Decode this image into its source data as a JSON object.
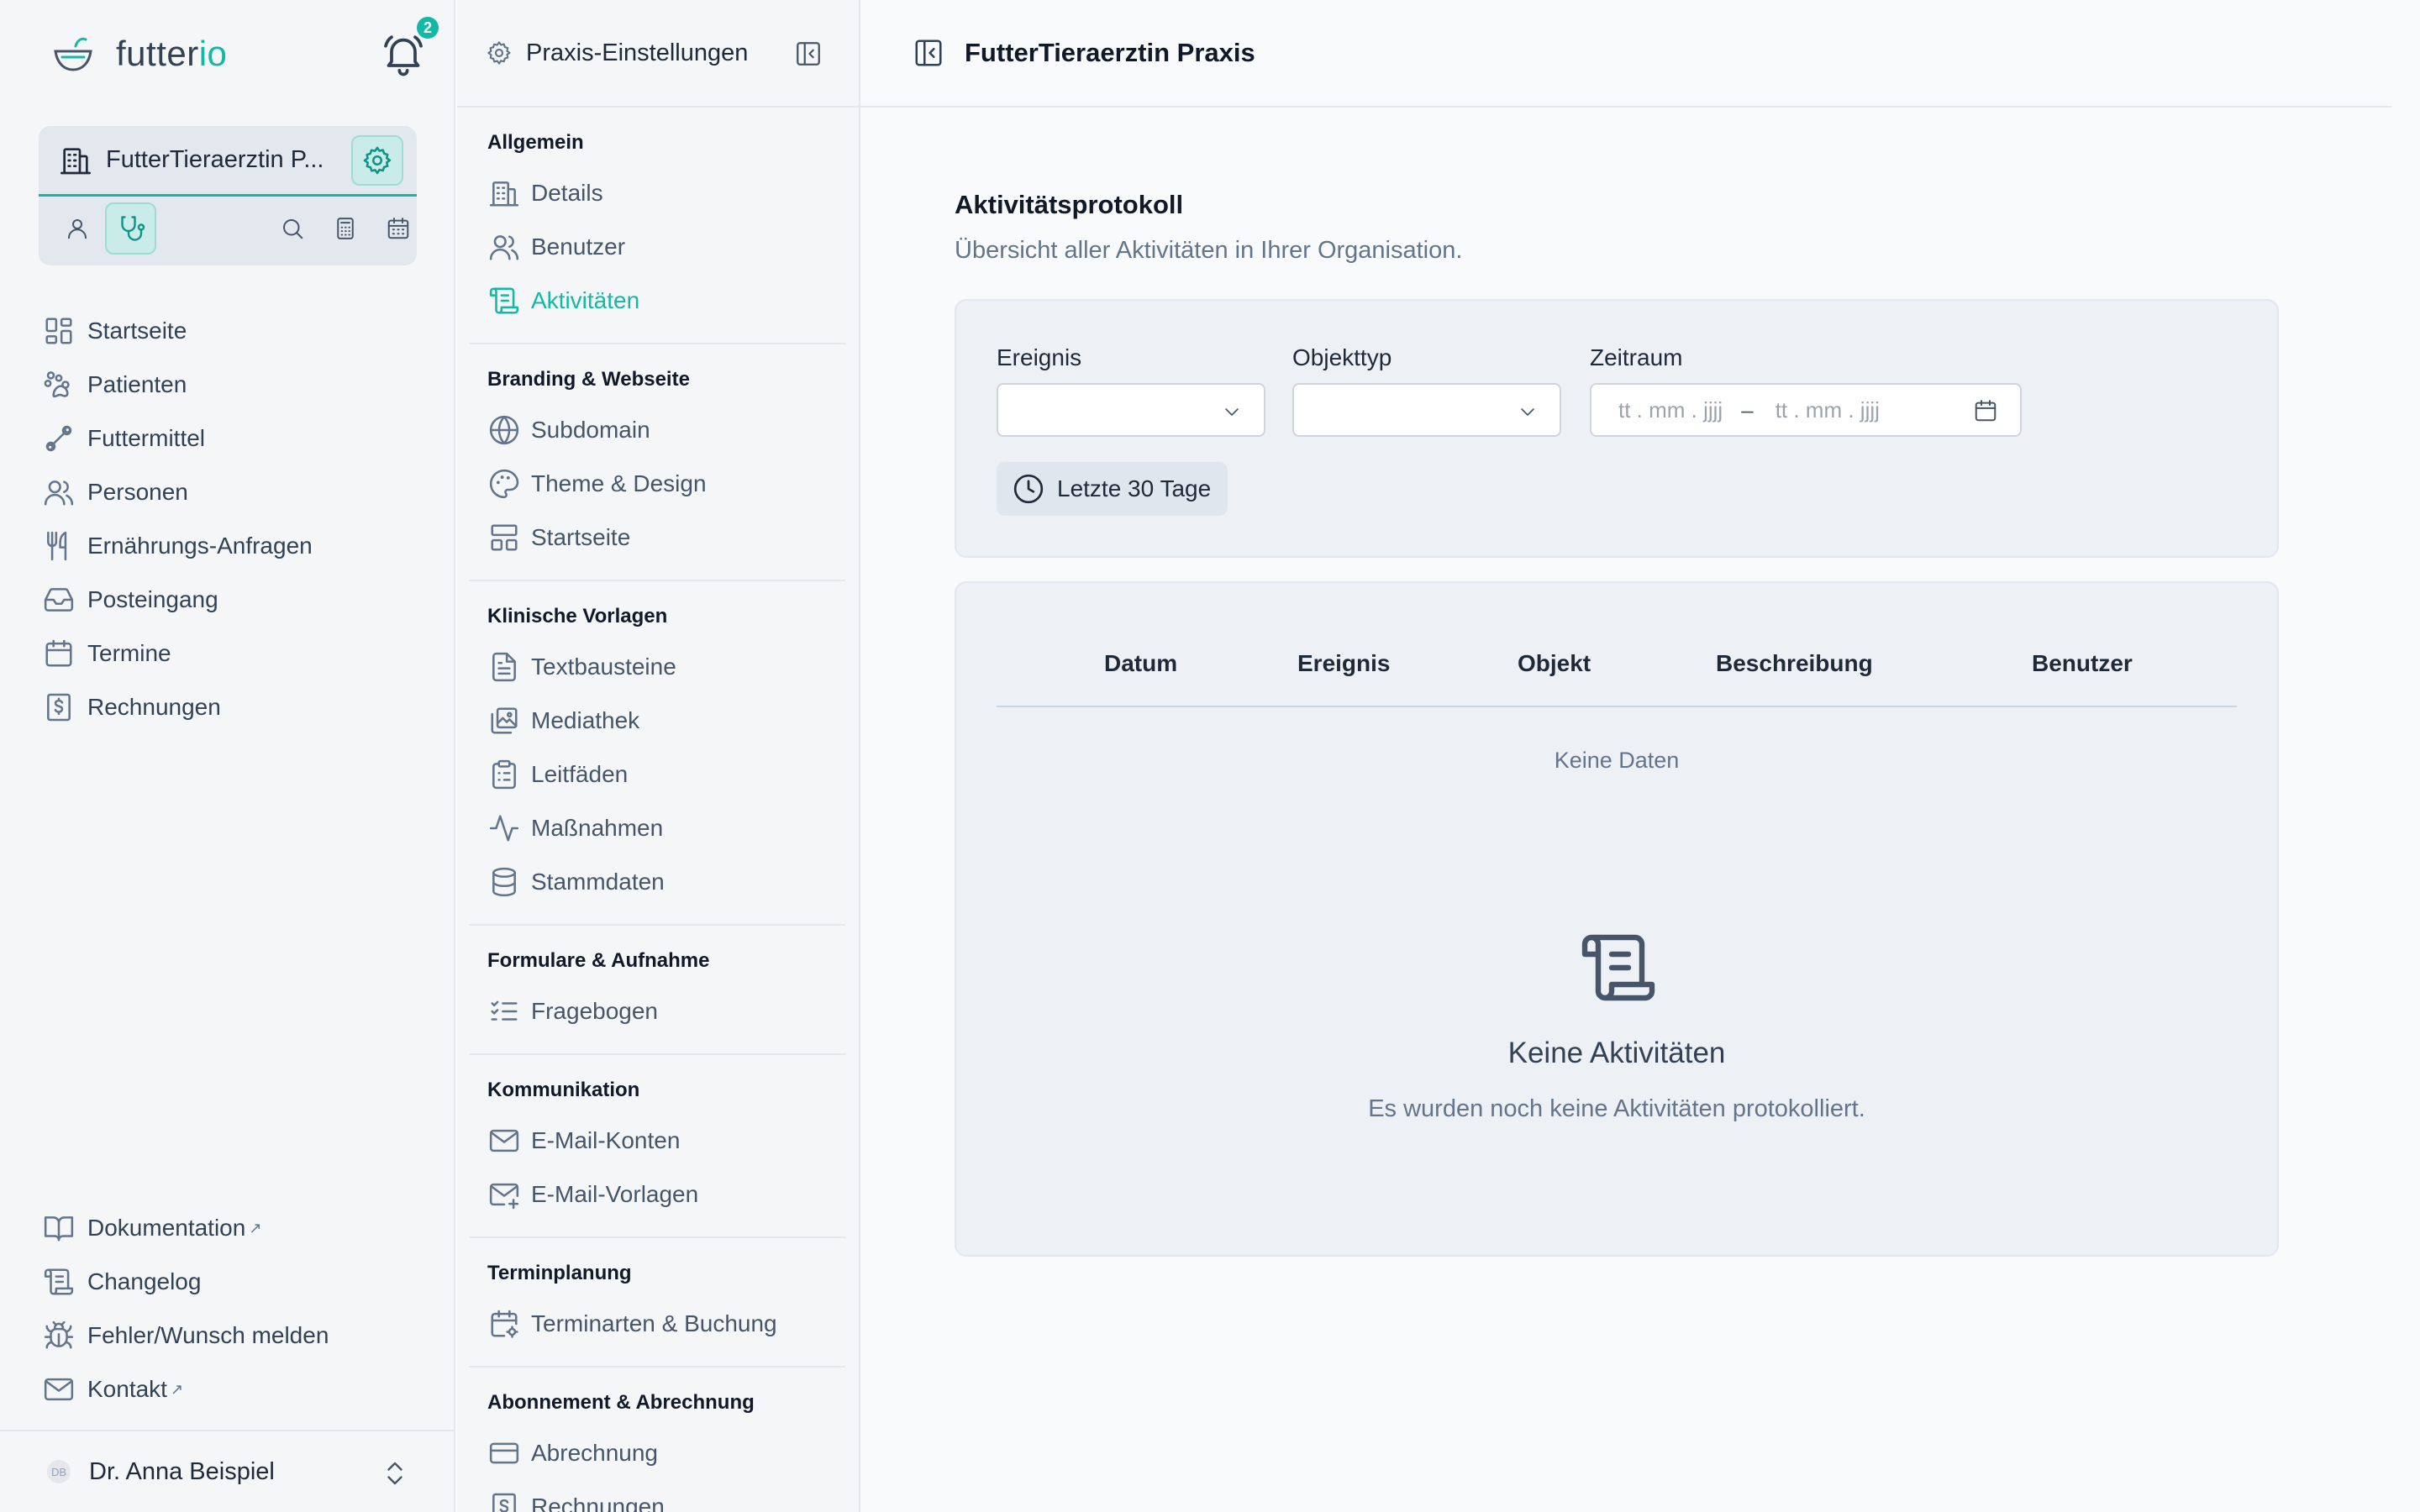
{
  "brand": {
    "name_main": "futter",
    "name_accent": "io",
    "notification_count": "2"
  },
  "org": {
    "name": "FutterTieraerztin P..."
  },
  "nav": {
    "items": [
      {
        "label": "Startseite",
        "icon": "dashboard-icon"
      },
      {
        "label": "Patienten",
        "icon": "paw-icon"
      },
      {
        "label": "Futtermittel",
        "icon": "bone-icon"
      },
      {
        "label": "Personen",
        "icon": "users-icon"
      },
      {
        "label": "Ernährungs-Anfragen",
        "icon": "utensils-icon"
      },
      {
        "label": "Posteingang",
        "icon": "inbox-icon"
      },
      {
        "label": "Termine",
        "icon": "calendar-icon"
      },
      {
        "label": "Rechnungen",
        "icon": "invoice-icon"
      }
    ],
    "footer": [
      {
        "label": "Dokumentation",
        "icon": "book-icon",
        "external": "↗"
      },
      {
        "label": "Changelog",
        "icon": "scroll-icon",
        "external": ""
      },
      {
        "label": "Fehler/Wunsch melden",
        "icon": "bug-icon",
        "external": ""
      },
      {
        "label": "Kontakt",
        "icon": "mail-icon",
        "external": "↗"
      }
    ]
  },
  "user": {
    "initials": "DB",
    "name": "Dr. Anna Beispiel"
  },
  "settings": {
    "title": "Praxis-Einstellungen",
    "sections": [
      {
        "title": "Allgemein",
        "items": [
          {
            "label": "Details",
            "icon": "building-icon"
          },
          {
            "label": "Benutzer",
            "icon": "users-icon"
          },
          {
            "label": "Aktivitäten",
            "icon": "scroll-icon",
            "active": true
          }
        ]
      },
      {
        "title": "Branding & Webseite",
        "items": [
          {
            "label": "Subdomain",
            "icon": "globe-icon"
          },
          {
            "label": "Theme & Design",
            "icon": "palette-icon"
          },
          {
            "label": "Startseite",
            "icon": "layout-icon"
          }
        ]
      },
      {
        "title": "Klinische Vorlagen",
        "items": [
          {
            "label": "Textbausteine",
            "icon": "document-icon"
          },
          {
            "label": "Mediathek",
            "icon": "images-icon"
          },
          {
            "label": "Leitfäden",
            "icon": "clipboard-icon"
          },
          {
            "label": "Maßnahmen",
            "icon": "activity-icon"
          },
          {
            "label": "Stammdaten",
            "icon": "database-icon"
          }
        ]
      },
      {
        "title": "Formulare & Aufnahme",
        "items": [
          {
            "label": "Fragebogen",
            "icon": "checklist-icon"
          }
        ]
      },
      {
        "title": "Kommunikation",
        "items": [
          {
            "label": "E-Mail-Konten",
            "icon": "mail-icon"
          },
          {
            "label": "E-Mail-Vorlagen",
            "icon": "mail-plus-icon"
          }
        ]
      },
      {
        "title": "Terminplanung",
        "items": [
          {
            "label": "Terminarten & Buchung",
            "icon": "calendar-gear-icon"
          }
        ]
      },
      {
        "title": "Abonnement & Abrechnung",
        "items": [
          {
            "label": "Abrechnung",
            "icon": "credit-card-icon"
          },
          {
            "label": "Rechnungen",
            "icon": "invoice-icon"
          }
        ]
      }
    ]
  },
  "main": {
    "header_title": "FutterTieraerztin Praxis",
    "page_title": "Aktivitätsprotokoll",
    "page_subtitle": "Übersicht aller Aktivitäten in Ihrer Organisation.",
    "filters": {
      "event_label": "Ereignis",
      "event_value": "",
      "objecttype_label": "Objekttyp",
      "objecttype_value": "",
      "range_label": "Zeitraum",
      "range_from_placeholder": "tt . mm . jjjj",
      "range_separator": "–",
      "range_to_placeholder": "tt . mm . jjjj",
      "quick_range_button": "Letzte 30 Tage"
    },
    "table": {
      "columns": [
        "Datum",
        "Ereignis",
        "Objekt",
        "Beschreibung",
        "Benutzer"
      ],
      "rows": [],
      "no_data": "Keine Daten"
    },
    "empty": {
      "title": "Keine Aktivitäten",
      "subtitle": "Es wurden noch keine Aktivitäten protokolliert."
    }
  },
  "colors": {
    "accent": "#14b8a6",
    "sidebar_bg": "#f4f6f8",
    "card_bg": "#edf1f5"
  }
}
